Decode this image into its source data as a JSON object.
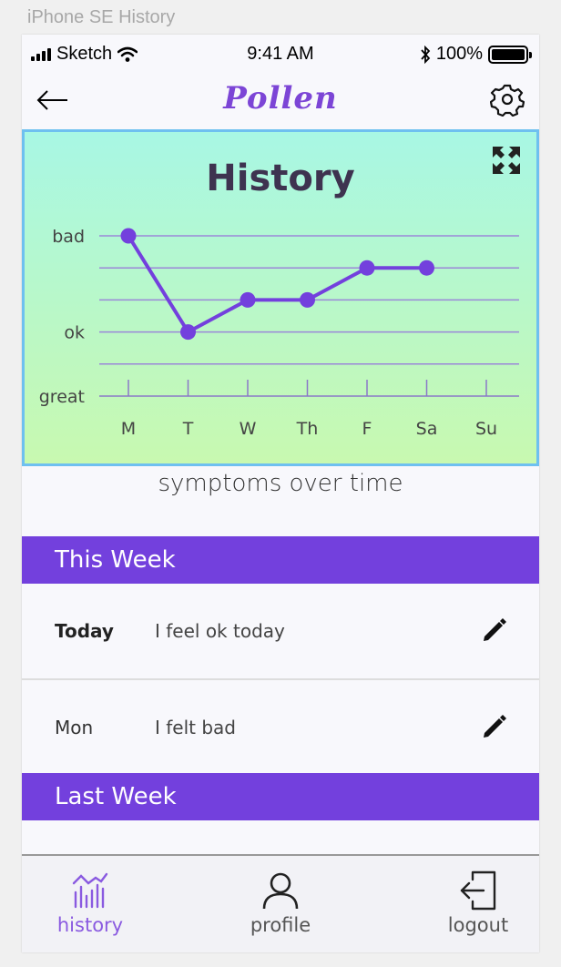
{
  "frame": {
    "title": "iPhone SE History"
  },
  "status_bar": {
    "carrier": "Sketch",
    "time": "9:41 AM",
    "battery": "100%",
    "battery_level": 1.0
  },
  "nav": {
    "logo": "Pollen",
    "back_icon": "arrow-left-icon",
    "settings_icon": "gear-icon"
  },
  "chart": {
    "title": "History",
    "expand_icon": "expand-icon",
    "caption": "symptoms over time"
  },
  "chart_data": {
    "type": "line",
    "title": "History",
    "categories": [
      "M",
      "T",
      "W",
      "Th",
      "F",
      "Sa",
      "Su"
    ],
    "y_tick_labels": [
      "great",
      "ok",
      "bad"
    ],
    "ylim": [
      0,
      5
    ],
    "values": [
      5,
      2,
      3,
      3,
      4,
      4,
      null
    ],
    "grid": true,
    "line_color": "#7340dd"
  },
  "this_week": {
    "header": "This Week",
    "entries": [
      {
        "day": "Today",
        "text": "I feel ok today",
        "bold": true
      },
      {
        "day": "Mon",
        "text": "I felt bad",
        "bold": false
      }
    ]
  },
  "last_week": {
    "header": "Last Week"
  },
  "tabs": [
    {
      "label": "history",
      "icon": "history-chart-icon",
      "active": true
    },
    {
      "label": "profile",
      "icon": "user-icon",
      "active": false
    },
    {
      "label": "logout",
      "icon": "logout-icon",
      "active": false
    }
  ],
  "colors": {
    "accent": "#7340dd",
    "panel_border": "#6ec0f0",
    "active_tab": "#8a5ae0"
  }
}
